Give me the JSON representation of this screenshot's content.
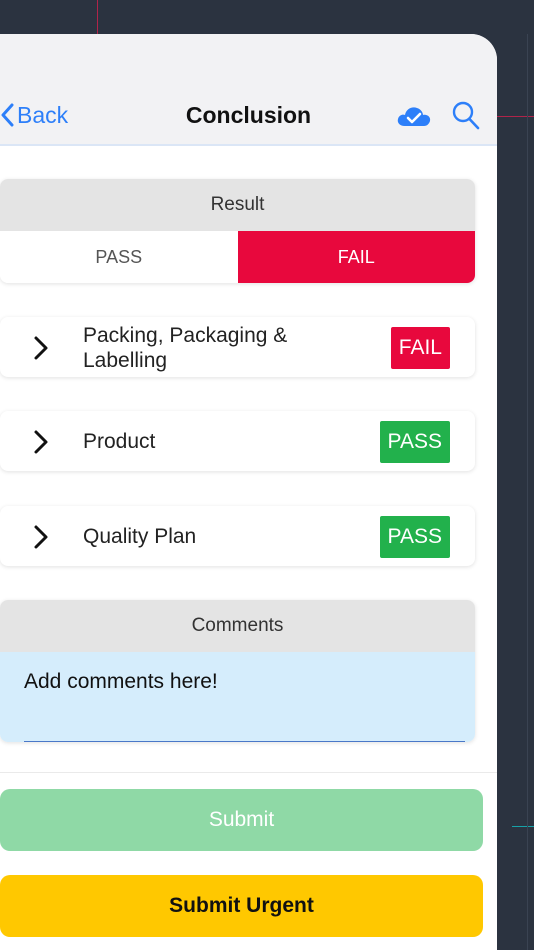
{
  "navbar": {
    "back_label": "Back",
    "title": "Conclusion",
    "cloud_icon": "cloud-check-icon",
    "search_icon": "search-icon"
  },
  "result": {
    "header": "Result",
    "pass_label": "PASS",
    "fail_label": "FAIL",
    "selected": "FAIL"
  },
  "sections": [
    {
      "label_line1": "Packing, Packaging &",
      "label_line2": "Labelling",
      "status": "FAIL"
    },
    {
      "label_line1": "Product",
      "label_line2": "",
      "status": "PASS"
    },
    {
      "label_line1": "Quality Plan",
      "label_line2": "",
      "status": "PASS"
    }
  ],
  "comments": {
    "header": "Comments",
    "value": "Add comments here!"
  },
  "buttons": {
    "submit_label": "Submit",
    "urgent_label": "Submit Urgent"
  },
  "colors": {
    "accent_blue": "#2d7ff9",
    "fail_red": "#e8083d",
    "pass_green": "#22b14c",
    "submit_green": "#8fd9a6",
    "urgent_yellow": "#ffc800"
  }
}
